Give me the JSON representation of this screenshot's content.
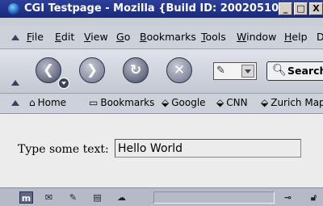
{
  "window": {
    "title": "CGI Testpage - Mozilla {Build ID: 20020510...",
    "controls": [
      "_",
      "□",
      "X"
    ]
  },
  "menu": [
    "File",
    "Edit",
    "View",
    "Go",
    "Bookmarks",
    "Tools",
    "Window",
    "Help",
    "D"
  ],
  "menu_mnemonics": [
    "F",
    "E",
    "V",
    "G",
    "B",
    "T",
    "W",
    "H",
    ""
  ],
  "navigation": {
    "back_glyph": "❮",
    "forward_glyph": "❯",
    "reload_glyph": "↻",
    "stop_glyph": "✕",
    "search_label": "Search"
  },
  "personal_toolbar": [
    "Home",
    "Bookmarks",
    "Google",
    "CNN",
    "Zurich Map"
  ],
  "content": {
    "label": "Type some text:",
    "input_value": "Hello World"
  },
  "status_icons": [
    "navigator-icon",
    "mail-icon",
    "composer-icon",
    "addressbook-icon",
    "chat-icon"
  ]
}
